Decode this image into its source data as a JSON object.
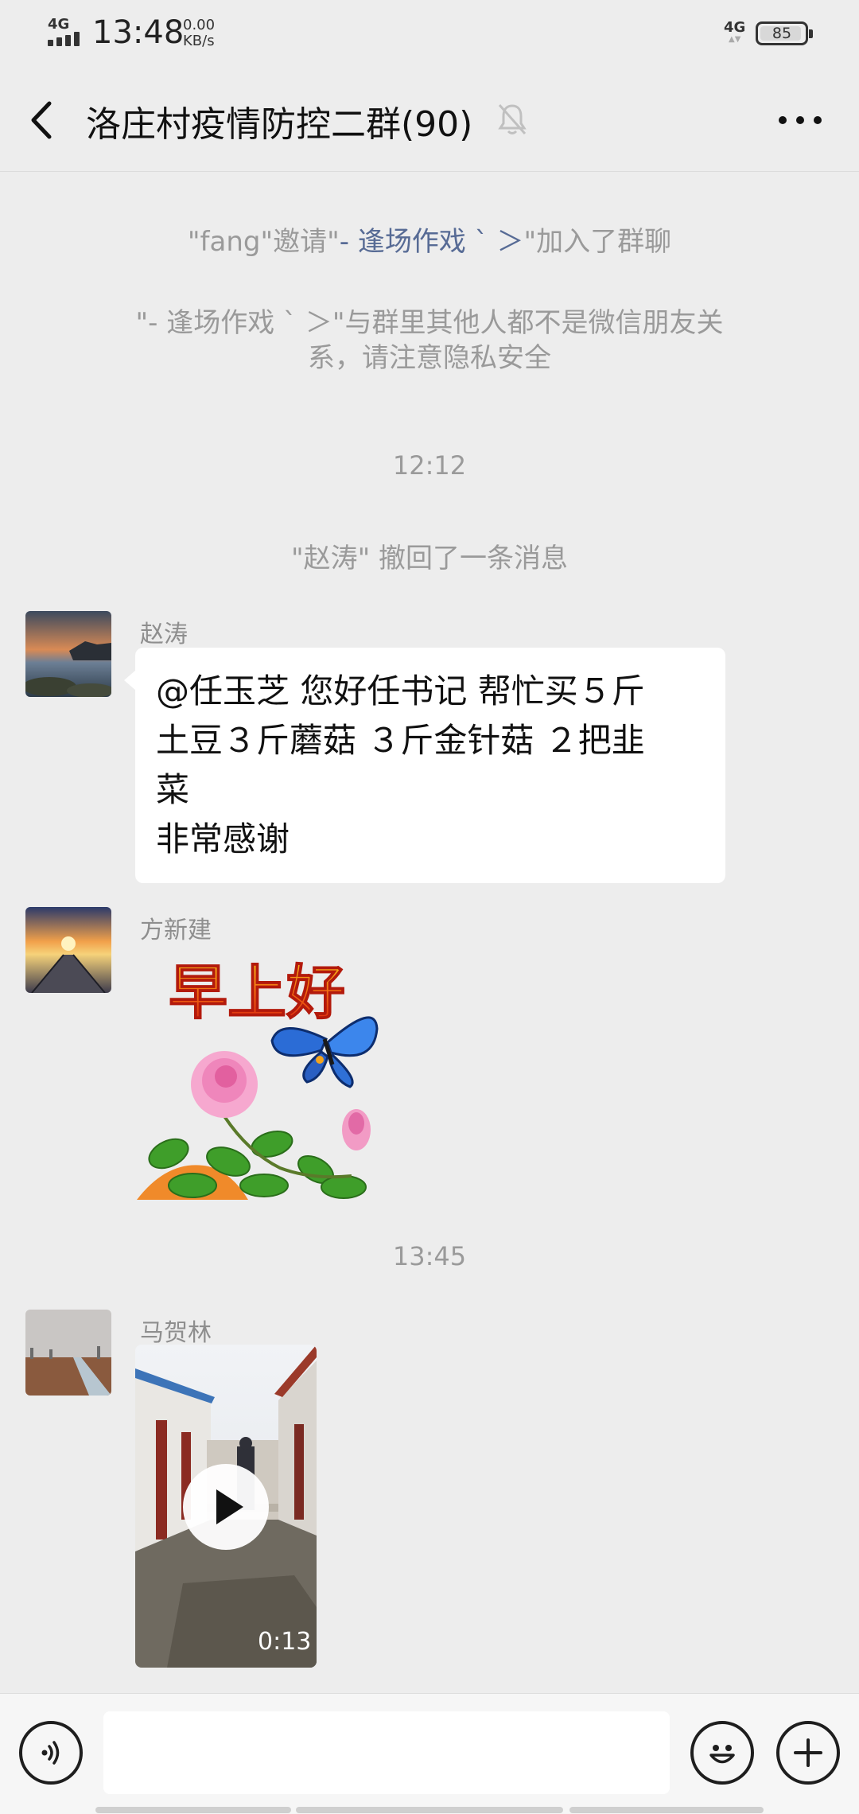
{
  "status_bar": {
    "network_left": "4G",
    "time": "13:48",
    "speed_value": "0.00",
    "speed_unit": "KB/s",
    "network_right": "4G",
    "battery": "85"
  },
  "header": {
    "title": "洛庄村疫情防控二群(90)",
    "muted": true
  },
  "system_messages": {
    "invite_prefix": "\"fang\"邀请\"",
    "invite_name": "- 逢场作戏 ˋ ＞",
    "invite_suffix": "\"加入了群聊",
    "privacy_line1": "\"- 逢场作戏 ˋ ＞\"与群里其他人都不是微信朋友关",
    "privacy_line2": "系，请注意隐私安全",
    "time_1": "12:12",
    "recall": "\"赵涛\" 撤回了一条消息",
    "time_2": "13:45"
  },
  "messages": [
    {
      "sender": "赵涛",
      "type": "text",
      "lines": [
        "@任玉芝  您好任书记  帮忙买５斤",
        "土豆３斤蘑菇  ３斤金针菇  ２把韭",
        "菜",
        "非常感谢"
      ]
    },
    {
      "sender": "方新建",
      "type": "sticker",
      "sticker_text": "早上好"
    },
    {
      "sender": "马贺林",
      "type": "video",
      "duration": "0:13"
    }
  ],
  "colors": {
    "background": "#ededed",
    "link": "#576b95",
    "system_text": "#9a9a9a"
  }
}
